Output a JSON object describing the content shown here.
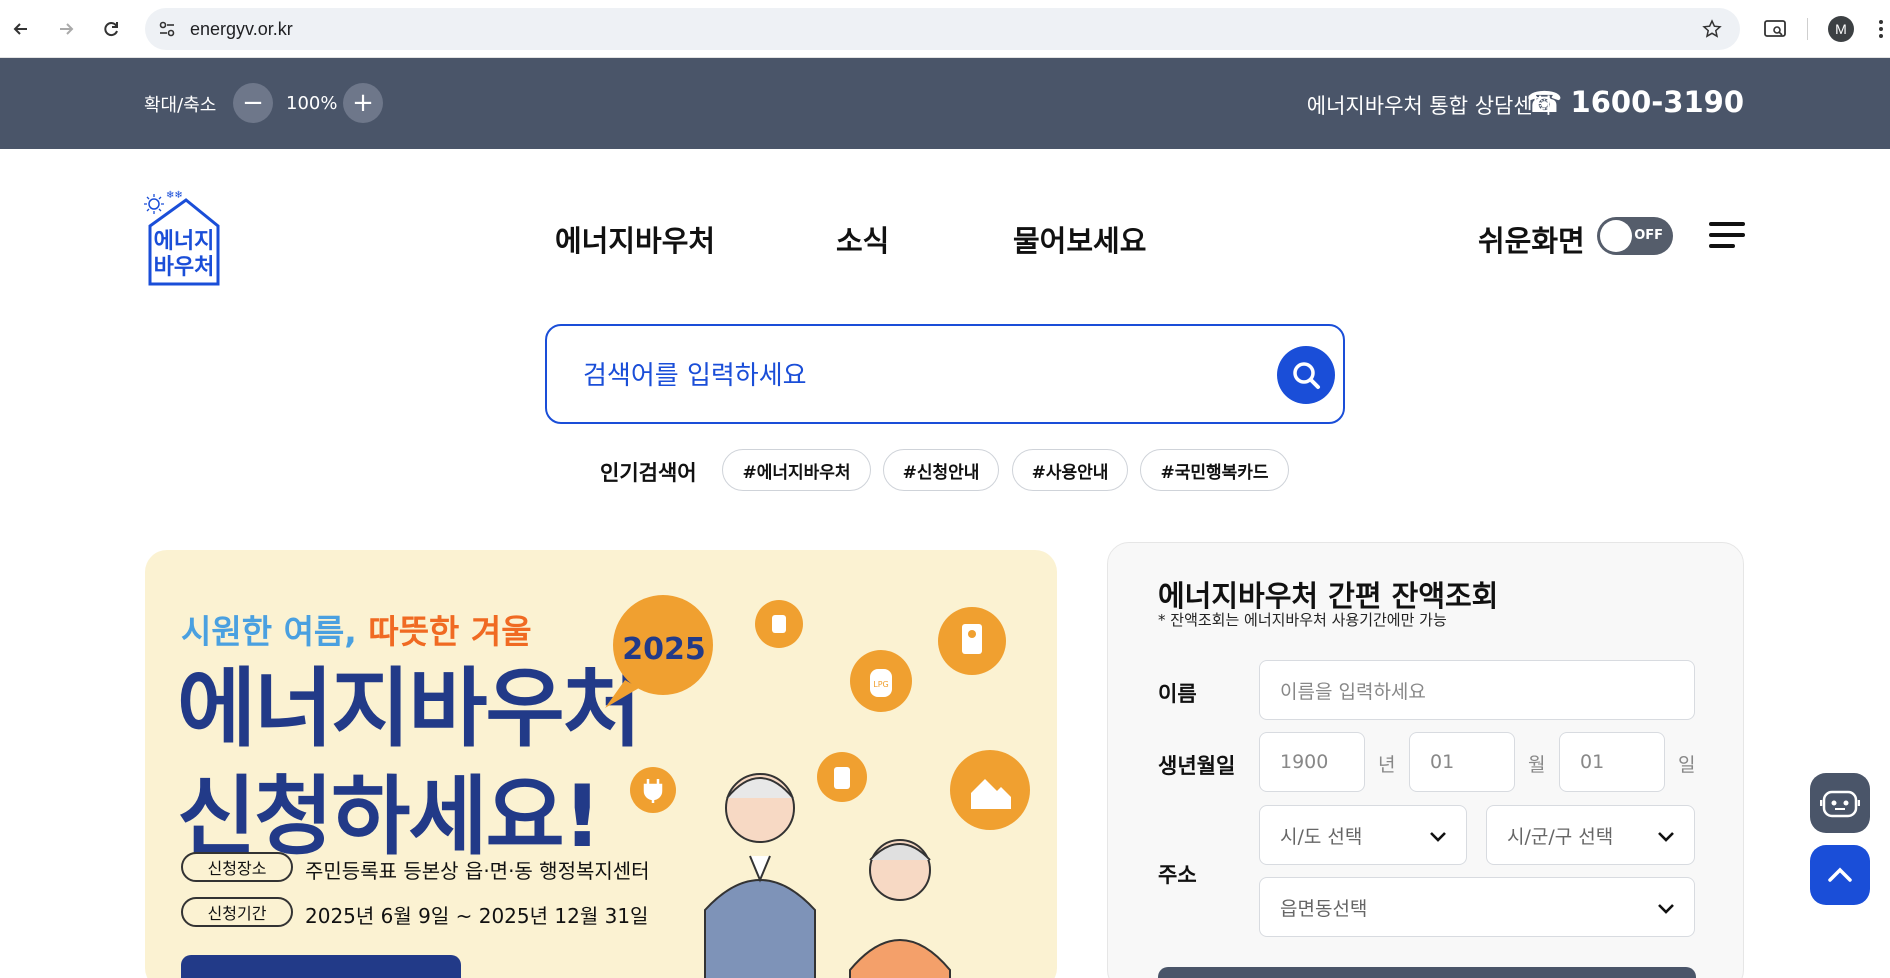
{
  "browser": {
    "url": "energyv.or.kr",
    "profile_initial": "M"
  },
  "top_strip": {
    "zoom_label": "확대/축소",
    "zoom_minus": "−",
    "zoom_value": "100%",
    "zoom_plus": "+",
    "center_label": "에너지바우처 통합 상담센터",
    "phone_icon": "☎",
    "phone": "1600-3190"
  },
  "header": {
    "logo_line1": "에너지",
    "logo_line2": "바우처",
    "nav": [
      {
        "label": "에너지바우처"
      },
      {
        "label": "소식"
      },
      {
        "label": "물어보세요"
      }
    ],
    "easy_mode_label": "쉬운화면",
    "toggle_state": "OFF"
  },
  "search": {
    "placeholder": "검색어를 입력하세요",
    "popular_label": "인기검색어",
    "tags": [
      "#에너지바우처",
      "#신청안내",
      "#사용안내",
      "#국민행복카드"
    ]
  },
  "banner": {
    "subtitle_cool": "시원한 여름,",
    "subtitle_warm": "따뜻한 겨울",
    "title_line1": "에너지바우처",
    "title_line2": "신청하세요!",
    "year": "2025",
    "place_label": "신청장소",
    "place_value": "주민등록표 등본상 읍·면·동 행정복지센터",
    "period_label": "신청기간",
    "period_value": "2025년 6월 9일 ~ 2025년 12월 31일",
    "colors": {
      "bg": "#fbf2d2",
      "title": "#223a88",
      "accent": "#f0a030"
    }
  },
  "balance": {
    "title": "에너지바우처 간편 잔액조회",
    "note": "* 잔액조회는 에너지바우처 사용기간에만 가능",
    "name_label": "이름",
    "name_placeholder": "이름을 입력하세요",
    "birth_label": "생년월일",
    "year_placeholder": "1900",
    "year_unit": "년",
    "month_placeholder": "01",
    "month_unit": "월",
    "day_placeholder": "01",
    "day_unit": "일",
    "address_label": "주소",
    "sido_select": "시/도 선택",
    "sigungu_select": "시/군/구 선택",
    "eupmyeondong_select": "읍면동선택"
  },
  "colors": {
    "strip": "#4a5569",
    "primary": "#1a4ed8"
  }
}
